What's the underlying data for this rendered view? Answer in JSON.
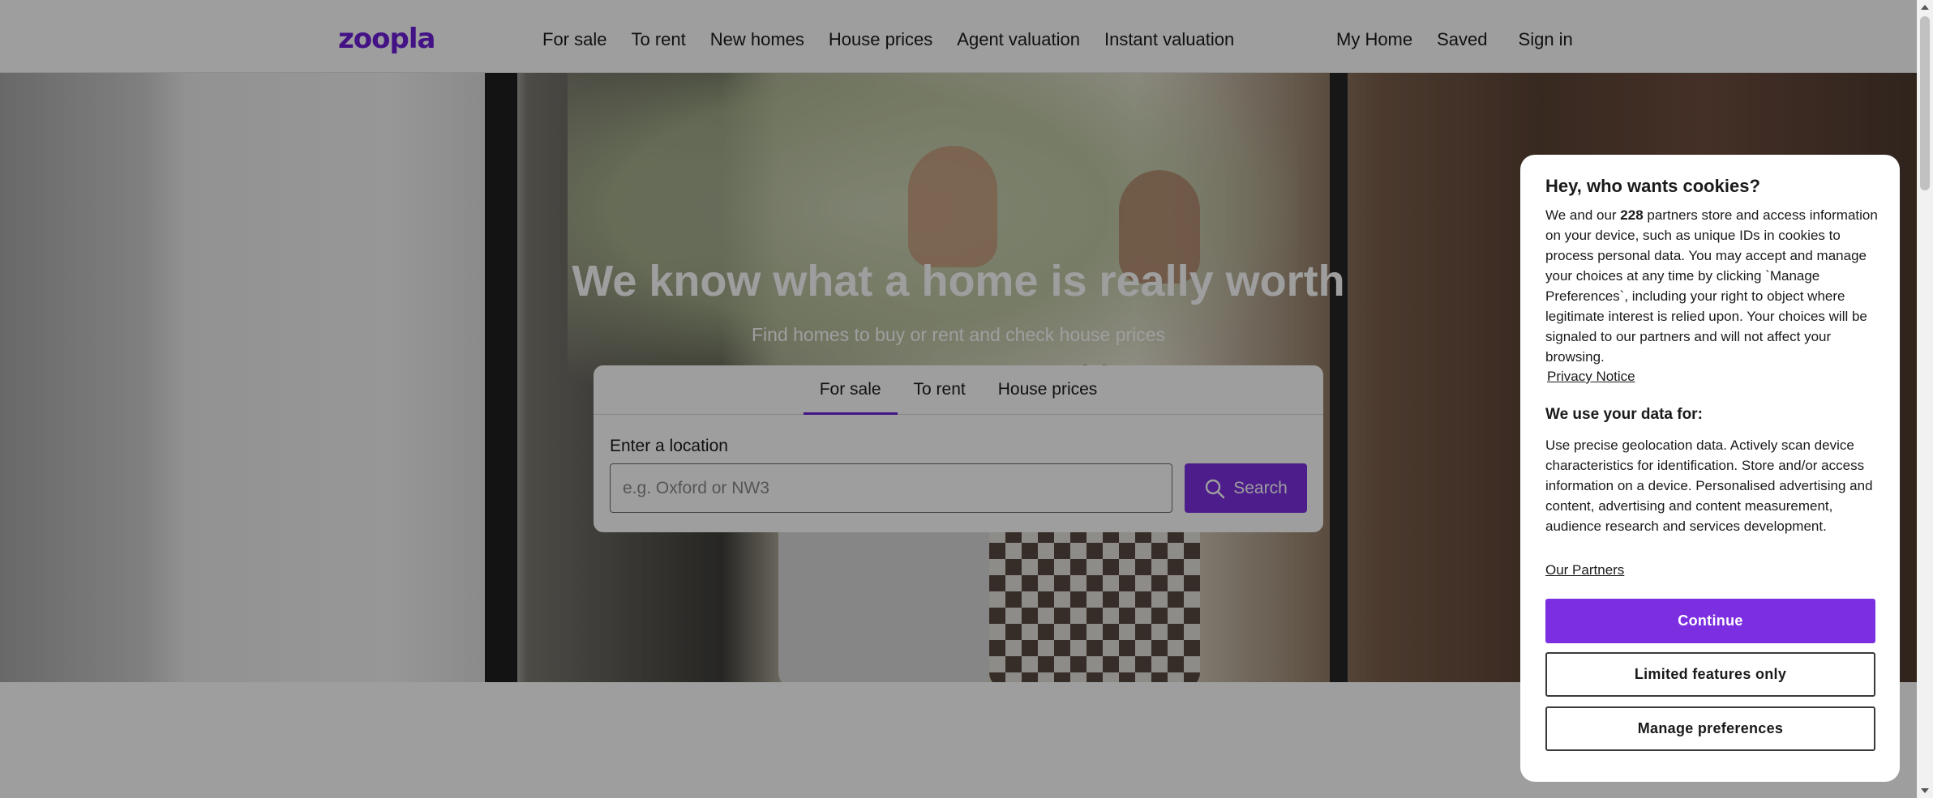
{
  "header": {
    "logo": "zoopla",
    "nav": [
      "For sale",
      "To rent",
      "New homes",
      "House prices",
      "Agent valuation",
      "Instant valuation"
    ],
    "nav_right": [
      "My Home",
      "Saved",
      "Sign in"
    ]
  },
  "hero": {
    "title": "We know what a home is really worth",
    "subtitle": "Find homes to buy or rent and check house prices"
  },
  "search": {
    "tabs": [
      "For sale",
      "To rent",
      "House prices"
    ],
    "active_tab": "For sale",
    "location_label": "Enter a location",
    "placeholder": "e.g. Oxford or NW3",
    "value": "",
    "button_label": "Search"
  },
  "cookie": {
    "title": "Hey, who wants cookies?",
    "body_pre": "We and our ",
    "partner_count": "228",
    "body_post": " partners store and access information on your device, such as unique IDs in cookies to process personal data. You may accept and manage your choices at any time by clicking `Manage Preferences`, including your right to object where legitimate interest is relied upon. Your choices will be signaled to our partners and will not affect your browsing.",
    "privacy_link": "Privacy Notice",
    "data_heading": "We use your data for:",
    "purposes": "Use precise geolocation data. Actively scan device characteristics for identification. Store and/or access information on a device. Personalised advertising and content, advertising and content measurement, audience research and services development.",
    "partners_link": "Our Partners",
    "continue_label": "Continue",
    "limited_label": "Limited features only",
    "manage_label": "Manage preferences"
  },
  "colors": {
    "brand": "#6d1fd9",
    "button": "#7b2fe0"
  }
}
